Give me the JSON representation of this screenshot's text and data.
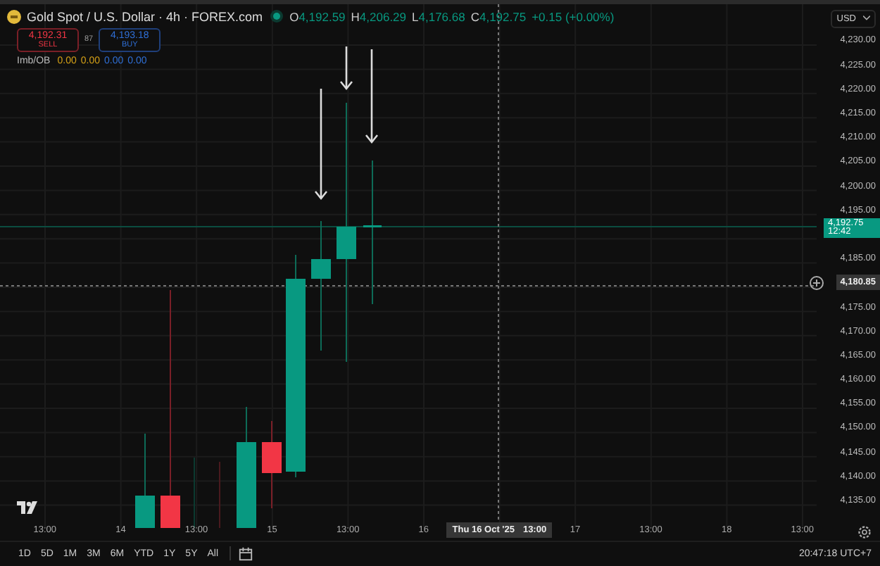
{
  "header": {
    "title": "Gold Spot / U.S. Dollar · 4h · FOREX.com",
    "market_open": true,
    "ohlc": [
      {
        "key": "O",
        "value": "4,192.59"
      },
      {
        "key": "H",
        "value": "4,206.29"
      },
      {
        "key": "L",
        "value": "4,176.68"
      },
      {
        "key": "C",
        "value": "4,192.75"
      }
    ],
    "change": "+0.15 (+0.00%)"
  },
  "trade": {
    "sell": {
      "price": "4,192.31",
      "label": "SELL"
    },
    "spread": "87",
    "buy": {
      "price": "4,193.18",
      "label": "BUY"
    }
  },
  "indicator": {
    "name": "Imb/OB",
    "values": [
      {
        "text": "0.00",
        "color": "#d4a017"
      },
      {
        "text": "0.00",
        "color": "#d4a017"
      },
      {
        "text": "0.00",
        "color": "#2f6fd6"
      },
      {
        "text": "0.00",
        "color": "#2f6fd6"
      }
    ]
  },
  "currency": "USD",
  "price_axis": [
    {
      "kind": "tick",
      "text": "4,230.00"
    },
    {
      "kind": "tick",
      "text": "4,225.00"
    },
    {
      "kind": "tick",
      "text": "4,220.00"
    },
    {
      "kind": "tick",
      "text": "4,215.00"
    },
    {
      "kind": "tick",
      "text": "4,210.00"
    },
    {
      "kind": "tick",
      "text": "4,205.00"
    },
    {
      "kind": "tick",
      "text": "4,200.00"
    },
    {
      "kind": "tick",
      "text": "4,195.00"
    },
    {
      "kind": "last_price",
      "text": "4,192.75",
      "countdown": "12:42"
    },
    {
      "kind": "tick",
      "text": "4,185.00"
    },
    {
      "kind": "crosshair",
      "text": "4,180.85"
    },
    {
      "kind": "tick",
      "text": "4,175.00"
    },
    {
      "kind": "tick",
      "text": "4,170.00"
    },
    {
      "kind": "tick",
      "text": "4,165.00"
    },
    {
      "kind": "tick",
      "text": "4,160.00"
    },
    {
      "kind": "tick",
      "text": "4,155.00"
    },
    {
      "kind": "tick",
      "text": "4,150.00"
    },
    {
      "kind": "tick",
      "text": "4,145.00"
    },
    {
      "kind": "tick",
      "text": "4,140.00"
    },
    {
      "kind": "tick",
      "text": "4,135.00"
    }
  ],
  "time_axis": [
    {
      "kind": "tick",
      "text": "13:00"
    },
    {
      "kind": "tick",
      "text": "14"
    },
    {
      "kind": "tick",
      "text": "13:00"
    },
    {
      "kind": "tick",
      "text": "15"
    },
    {
      "kind": "tick",
      "text": "13:00"
    },
    {
      "kind": "tick",
      "text": "16"
    },
    {
      "kind": "crosshair",
      "text": "Thu 16 Oct '25",
      "time": "13:00"
    },
    {
      "kind": "tick",
      "text": "17"
    },
    {
      "kind": "tick",
      "text": "13:00"
    },
    {
      "kind": "tick",
      "text": "18"
    },
    {
      "kind": "tick",
      "text": "13:00"
    }
  ],
  "ranges": [
    "1D",
    "5D",
    "1M",
    "3M",
    "6M",
    "YTD",
    "1Y",
    "5Y",
    "All"
  ],
  "clock": "20:47:18 UTC+7"
}
